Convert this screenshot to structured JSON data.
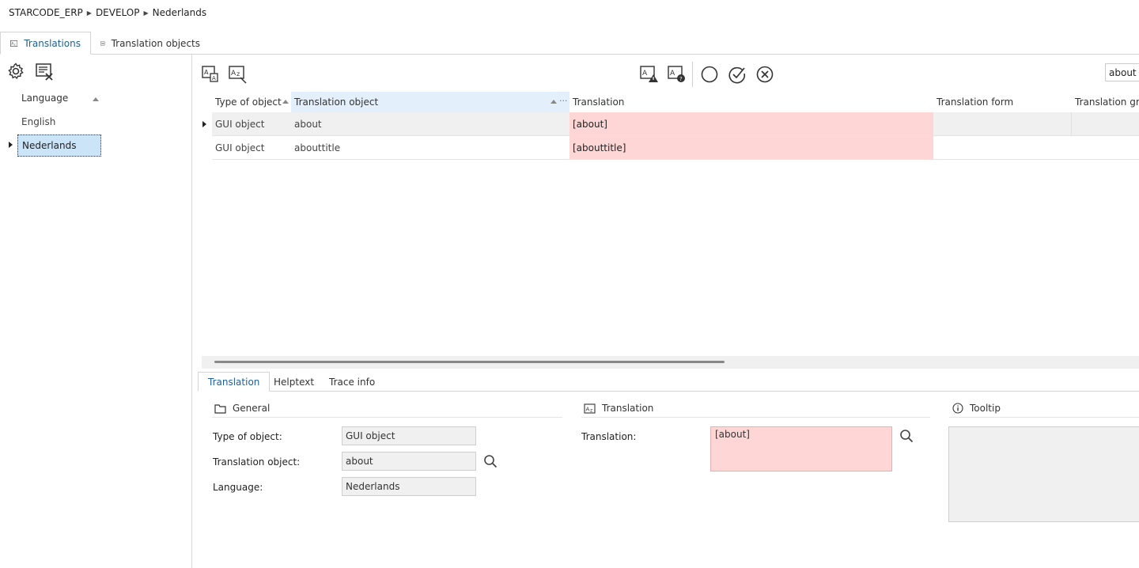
{
  "breadcrumb": {
    "part1": "STARCODE_ERP",
    "part2": "DEVELOP",
    "part3": "Nederlands"
  },
  "top_tabs": [
    {
      "label": "Translations",
      "active": true
    },
    {
      "label": "Translation objects",
      "active": false
    }
  ],
  "left": {
    "column_header": "Language",
    "languages": [
      {
        "label": "English",
        "selected": false
      },
      {
        "label": "Nederlands",
        "selected": true
      }
    ]
  },
  "grid": {
    "search_value": "about",
    "columns": [
      "Type of object",
      "Translation object",
      "Translation",
      "Translation form",
      "Translation grid"
    ],
    "rows": [
      {
        "type": "GUI object",
        "object": "about",
        "translation": "[about]",
        "form": "",
        "grid": ""
      },
      {
        "type": "GUI object",
        "object": "abouttitle",
        "translation": "[abouttitle]",
        "form": "",
        "grid": ""
      }
    ]
  },
  "detail_tabs": [
    {
      "label": "Translation",
      "active": true
    },
    {
      "label": "Helptext",
      "active": false
    },
    {
      "label": "Trace info",
      "active": false
    }
  ],
  "general": {
    "title": "General",
    "type_label": "Type of object:",
    "type_value": "GUI object",
    "object_label": "Translation object:",
    "object_value": "about",
    "language_label": "Language:",
    "language_value": "Nederlands"
  },
  "translation_section": {
    "title": "Translation",
    "label": "Translation:",
    "value": "[about]"
  },
  "tooltip_section": {
    "title": "Tooltip",
    "value": ""
  },
  "colors": {
    "accent": "#1e5f9a",
    "selected_bg": "#cce4f7",
    "untranslated_bg": "#ffd6d6",
    "header_highlight": "#e3f0fb"
  }
}
